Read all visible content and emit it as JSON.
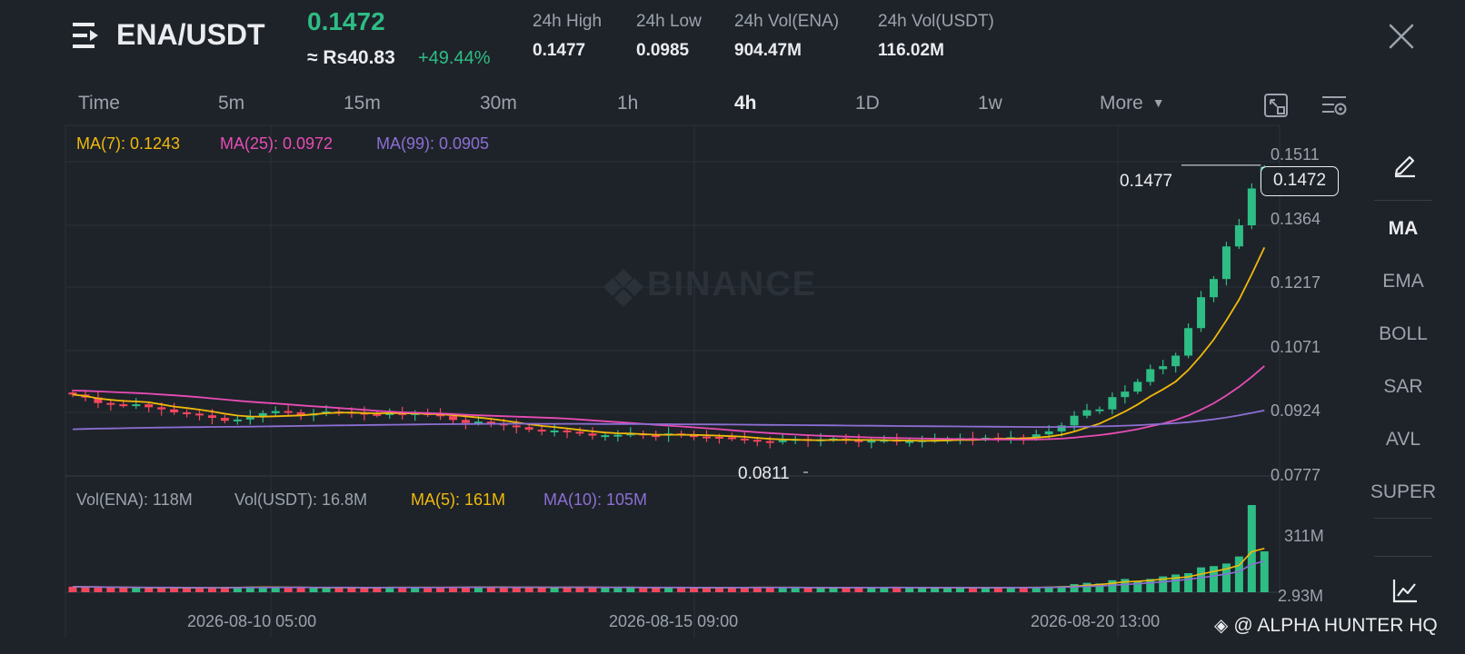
{
  "header": {
    "pair": "ENA/USDT",
    "price": "0.1472",
    "price_local": "≈ Rs40.83",
    "change": "+49.44%",
    "stats": [
      {
        "label": "24h High",
        "value": "0.1477"
      },
      {
        "label": "24h Low",
        "value": "0.0985"
      },
      {
        "label": "24h Vol(ENA)",
        "value": "904.47M"
      },
      {
        "label": "24h Vol(USDT)",
        "value": "116.02M"
      }
    ],
    "menu_icon": "menu-lines-icon",
    "close_icon": "close-icon"
  },
  "intervals": {
    "items": [
      "Time",
      "5m",
      "15m",
      "30m",
      "1h",
      "4h",
      "1D",
      "1w",
      "More"
    ],
    "active": "4h",
    "tools": [
      "fullscreen-icon",
      "chart-settings-icon"
    ]
  },
  "indicator_panel": {
    "items": [
      "MA",
      "EMA",
      "BOLL",
      "SAR",
      "AVL",
      "SUPER"
    ],
    "active": "MA",
    "top_icon": "pencil-draw-icon",
    "bottom_icon": "line-chart-icon"
  },
  "chart_data": {
    "type": "candlestick",
    "interval": "4h",
    "watermark": "BINANCE",
    "ma_legend": {
      "ma7": "MA(7): 0.1243",
      "ma25": "MA(25): 0.0972",
      "ma99": "MA(99): 0.0905"
    },
    "vol_legend": {
      "vol_ena": "Vol(ENA): 118M",
      "vol_usdt": "Vol(USDT): 16.8M",
      "ma5": "MA(5): 161M",
      "ma10": "MA(10): 105M"
    },
    "price_axis": [
      "0.1511",
      "0.1364",
      "0.1217",
      "0.1071",
      "0.0924",
      "0.0777"
    ],
    "volume_axis": [
      "311M",
      "2.93M"
    ],
    "x_labels": [
      "2026-08-10 05:00",
      "2026-08-15 09:00",
      "2026-08-20 13:00"
    ],
    "current_price": "0.1472",
    "period_high": "0.1477",
    "period_low": "0.0811",
    "ylim": [
      0.0777,
      0.1511
    ],
    "colors": {
      "up": "#2ebd85",
      "down": "#f6465d",
      "ma7": "#f0b90b",
      "ma25": "#e84cb5",
      "ma99": "#8c6fd4"
    },
    "closes": [
      0.0935,
      0.0928,
      0.0915,
      0.0912,
      0.091,
      0.0912,
      0.0905,
      0.09,
      0.0893,
      0.089,
      0.0886,
      0.088,
      0.0873,
      0.0876,
      0.0884,
      0.0891,
      0.0896,
      0.0893,
      0.0887,
      0.089,
      0.0895,
      0.0894,
      0.0892,
      0.0889,
      0.0887,
      0.0891,
      0.0888,
      0.0891,
      0.0888,
      0.0884,
      0.0875,
      0.0868,
      0.0871,
      0.0867,
      0.0862,
      0.0858,
      0.0852,
      0.0848,
      0.085,
      0.0847,
      0.0843,
      0.0838,
      0.0839,
      0.084,
      0.0843,
      0.0839,
      0.0838,
      0.0843,
      0.0839,
      0.0836,
      0.0835,
      0.0834,
      0.0831,
      0.0828,
      0.0825,
      0.0823,
      0.0827,
      0.083,
      0.0828,
      0.0829,
      0.0831,
      0.0827,
      0.0823,
      0.0826,
      0.0828,
      0.0824,
      0.0825,
      0.0827,
      0.0828,
      0.0829,
      0.0832,
      0.083,
      0.0833,
      0.0831,
      0.0834,
      0.0832,
      0.0841,
      0.0848,
      0.0862,
      0.0885,
      0.0898,
      0.09,
      0.0929,
      0.0942,
      0.0965,
      0.0995,
      0.1002,
      0.1027,
      0.1092,
      0.1165,
      0.1208,
      0.1285,
      0.1335,
      0.1422,
      0.1472
    ],
    "volumes_m": [
      6,
      5,
      4,
      3,
      3,
      3,
      2,
      3,
      3,
      2,
      3,
      3,
      4,
      5,
      6,
      4,
      3,
      3,
      4,
      3,
      3,
      3,
      3,
      3,
      4,
      5,
      3,
      3,
      3,
      4,
      6,
      5,
      4,
      4,
      3,
      4,
      5,
      4,
      3,
      4,
      5,
      4,
      3,
      3,
      4,
      3,
      3,
      4,
      3,
      3,
      3,
      3,
      4,
      4,
      4,
      3,
      4,
      3,
      3,
      3,
      3,
      4,
      4,
      3,
      3,
      4,
      3,
      3,
      3,
      3,
      3,
      3,
      4,
      3,
      4,
      3,
      5,
      6,
      8,
      14,
      18,
      16,
      26,
      30,
      24,
      30,
      38,
      44,
      48,
      66,
      70,
      78,
      100,
      260,
      116
    ]
  },
  "attribution": "@ ALPHA HUNTER HQ"
}
